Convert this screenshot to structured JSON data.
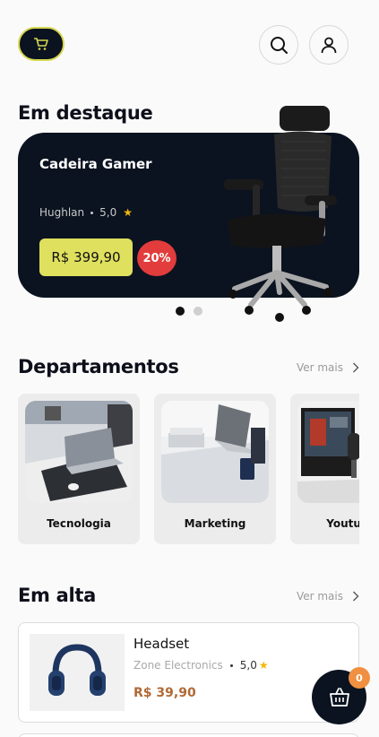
{
  "header": {
    "logo_icon": "cart-icon",
    "search_icon": "search-icon",
    "profile_icon": "user-icon",
    "accent_color": "#d6d750",
    "dark_color": "#0b1320"
  },
  "featured": {
    "section_title": "Em destaque",
    "product_name": "Cadeira Gamer",
    "brand": "Hughlan",
    "rating": "5,0",
    "price": "R$ 399,90",
    "discount": "20%",
    "carousel_pages": 2,
    "carousel_active": 1
  },
  "departments": {
    "section_title": "Departamentos",
    "see_more": "Ver mais",
    "items": [
      {
        "label": "Tecnologia"
      },
      {
        "label": "Marketing"
      },
      {
        "label": "Youtube"
      }
    ]
  },
  "trending": {
    "section_title": "Em alta",
    "see_more": "Ver mais",
    "products": [
      {
        "name": "Headset",
        "brand": "Zone Electronics",
        "rating": "5,0",
        "price": "R$ 39,90"
      }
    ]
  },
  "cart": {
    "count": "0",
    "icon": "shopping-bag-icon",
    "badge_color": "#f09040"
  }
}
